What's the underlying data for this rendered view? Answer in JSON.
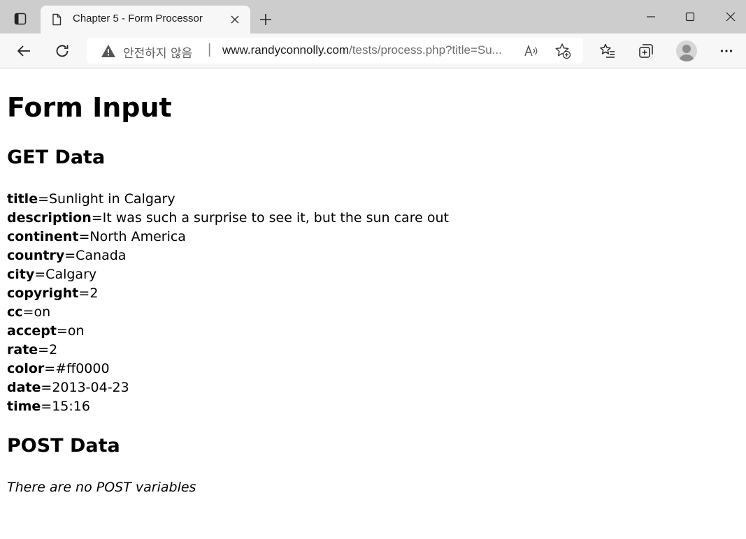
{
  "browser": {
    "tab": {
      "title": "Chapter 5 - Form Processor"
    },
    "address_bar": {
      "security_label": "안전하지 않음",
      "separator": "|",
      "url_host": "www.randyconnolly.com",
      "url_path": "/tests/process.php?title=Su..."
    },
    "colors": {
      "tabstrip_bg": "#cdcdcd",
      "toolbar_bg": "#f7f7f7"
    }
  },
  "page": {
    "title": "Form Input",
    "get_heading": "GET Data",
    "get_params": [
      {
        "key": "title",
        "value": "Sunlight in Calgary"
      },
      {
        "key": "description",
        "value": "It was such a surprise to see it, but the sun care out"
      },
      {
        "key": "continent",
        "value": "North America"
      },
      {
        "key": "country",
        "value": "Canada"
      },
      {
        "key": "city",
        "value": "Calgary"
      },
      {
        "key": "copyright",
        "value": "2"
      },
      {
        "key": "cc",
        "value": "on"
      },
      {
        "key": "accept",
        "value": "on"
      },
      {
        "key": "rate",
        "value": "2"
      },
      {
        "key": "color",
        "value": "#ff0000"
      },
      {
        "key": "date",
        "value": "2013-04-23"
      },
      {
        "key": "time",
        "value": "15:16"
      }
    ],
    "equals": "=",
    "post_heading": "POST Data",
    "post_message": "There are no POST variables"
  }
}
